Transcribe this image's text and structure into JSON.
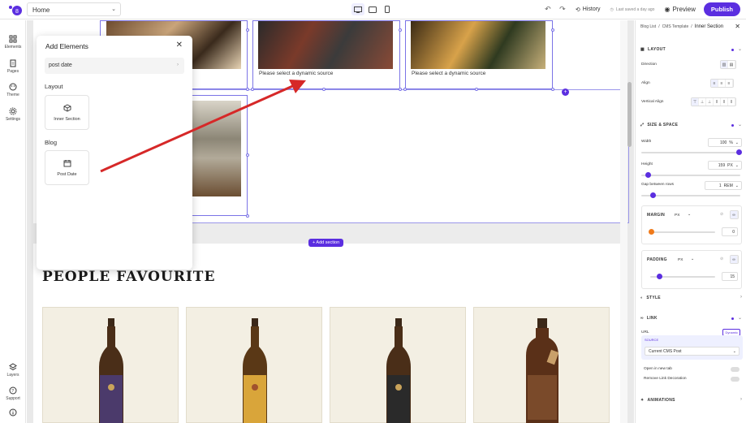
{
  "topbar": {
    "page_select": "Home",
    "history": "History",
    "saved": "Last saved a day ago",
    "preview": "Preview",
    "publish": "Publish"
  },
  "leftnav": {
    "items": [
      "Elements",
      "Pages",
      "Theme",
      "Settings"
    ],
    "bottom": [
      "Layers",
      "Support"
    ]
  },
  "canvas": {
    "cell_label": "Please select a dynamic source",
    "add_section": "+ Add section",
    "people_title": "PEOPLE FAVOURITE",
    "plus": "+"
  },
  "add_panel": {
    "title": "Add Elements",
    "search_value": "post date",
    "layout_heading": "Layout",
    "layout_item": "Inner Section",
    "blog_heading": "Blog",
    "blog_item": "Post Date"
  },
  "right_panel": {
    "breadcrumb": [
      "Blog List",
      "CMS Template",
      "Inner Section"
    ],
    "sections": {
      "layout": "LAYOUT",
      "size_space": "SIZE & SPACE",
      "style": "STYLE",
      "link": "LINK",
      "animations": "ANIMATIONS"
    },
    "labels": {
      "direction": "Direction",
      "align": "Align",
      "vertical_align": "Vertical Align",
      "width": "Width",
      "height": "Height",
      "gap": "Gap between rows",
      "margin": "MARGIN",
      "padding": "PADDING",
      "url": "URL",
      "source": "SOURCE",
      "open_new_tab": "Open in new tab",
      "remove_link_decoration": "Remove Link Decoration"
    },
    "values": {
      "width": "100",
      "width_unit": "%",
      "height": "159",
      "height_unit": "PX",
      "gap": "1",
      "gap_unit": "REM",
      "margin_unit": "PX",
      "margin": "0",
      "padding_unit": "PX",
      "padding": "15",
      "dynamic": "Dynamic",
      "source_value": "Current CMS Post"
    }
  },
  "colors": {
    "accent": "#5b2ee0",
    "selection": "#7b74e6",
    "arrow": "#d62828"
  }
}
